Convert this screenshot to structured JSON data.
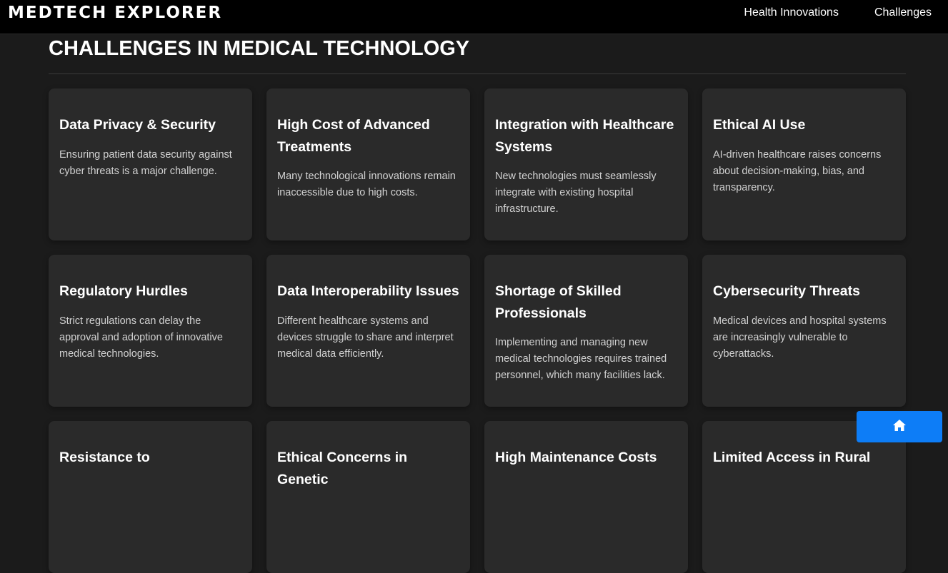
{
  "header": {
    "brand": "MEDTECH EXPLORER",
    "nav": [
      {
        "label": "Health Innovations"
      },
      {
        "label": "Challenges"
      }
    ]
  },
  "main": {
    "title": "CHALLENGES IN MEDICAL TECHNOLOGY",
    "cards": [
      {
        "title": "Data Privacy & Security",
        "text": "Ensuring patient data security against cyber threats is a major challenge."
      },
      {
        "title": "High Cost of Advanced Treatments",
        "text": "Many technological innovations remain inaccessible due to high costs."
      },
      {
        "title": "Integration with Healthcare Systems",
        "text": "New technologies must seamlessly integrate with existing hospital infrastructure."
      },
      {
        "title": "Ethical AI Use",
        "text": "AI-driven healthcare raises concerns about decision-making, bias, and transparency."
      },
      {
        "title": "Regulatory Hurdles",
        "text": "Strict regulations can delay the approval and adoption of innovative medical technologies."
      },
      {
        "title": "Data Interoperability Issues",
        "text": "Different healthcare systems and devices struggle to share and interpret medical data efficiently."
      },
      {
        "title": "Shortage of Skilled Professionals",
        "text": "Implementing and managing new medical technologies requires trained personnel, which many facilities lack."
      },
      {
        "title": "Cybersecurity Threats",
        "text": "Medical devices and hospital systems are increasingly vulnerable to cyberattacks."
      },
      {
        "title": "Resistance to",
        "text": ""
      },
      {
        "title": "Ethical Concerns in Genetic",
        "text": ""
      },
      {
        "title": "High Maintenance Costs",
        "text": ""
      },
      {
        "title": "Limited Access in Rural",
        "text": ""
      }
    ]
  },
  "home_button": {
    "icon": "home-icon"
  },
  "colors": {
    "accent": "#0d7df7",
    "card_bg": "#2a2a2a",
    "page_bg": "#1b1b1b",
    "topbar_bg": "#000000"
  }
}
